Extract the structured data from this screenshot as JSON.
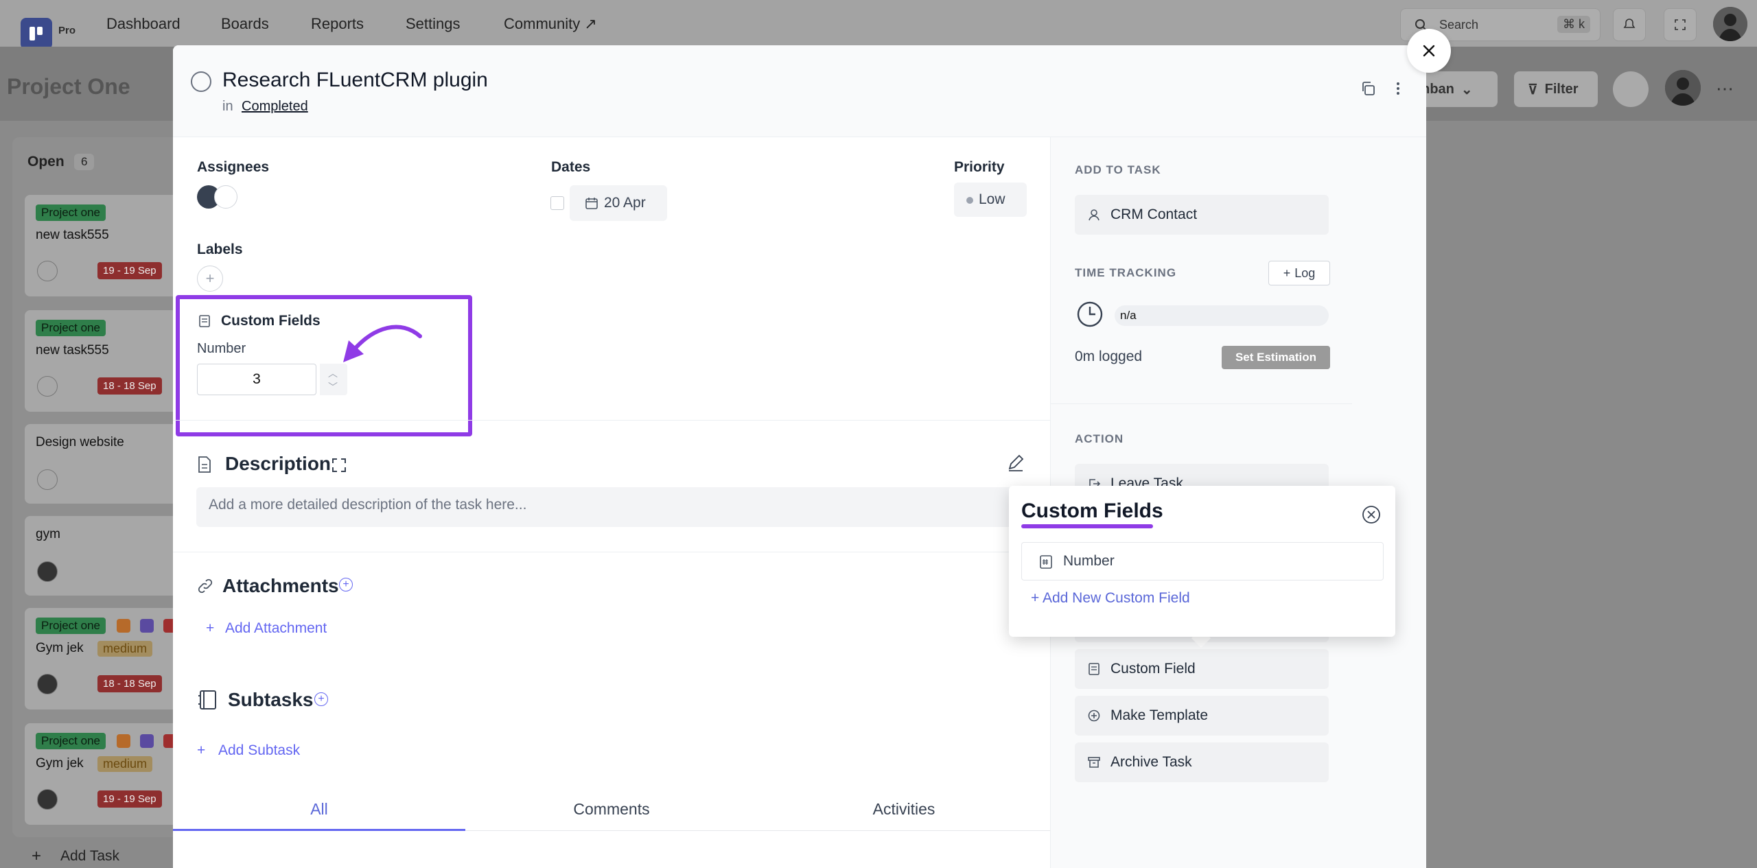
{
  "nav": {
    "brand": "Pro",
    "items": [
      "Dashboard",
      "Boards",
      "Reports",
      "Settings",
      "Community ↗"
    ],
    "search_label": "Search",
    "search_shortcut": "⌘ k"
  },
  "board": {
    "title": "Project One",
    "view_label": "anban",
    "filter_label": "Filter",
    "column": {
      "title": "Open",
      "count": "6",
      "cards": [
        {
          "tag": "Project one",
          "title": "new task555",
          "date": "19 - 19 Sep"
        },
        {
          "tag": "Project one",
          "title": "new task555",
          "date": "18 - 18 Sep"
        },
        {
          "title": "Design website"
        },
        {
          "title": "gym"
        },
        {
          "tag": "Project one",
          "title": "Gym jek",
          "priority": "medium",
          "date": "18 - 18 Sep"
        },
        {
          "tag": "Project one",
          "title": "Gym jek",
          "priority": "medium",
          "date": "19 - 19 Sep"
        }
      ],
      "add_task": "Add Task"
    }
  },
  "task": {
    "title": "Research FLuentCRM plugin",
    "in_label": "in",
    "stage": "Completed",
    "assignees_label": "Assignees",
    "dates_label": "Dates",
    "date_value": "20 Apr",
    "priority_label": "Priority",
    "priority_value": "Low",
    "labels_label": "Labels",
    "custom_fields_label": "Custom Fields",
    "number_label": "Number",
    "number_value": "3",
    "description_label": "Description",
    "description_placeholder": "Add a more detailed description of the task here...",
    "attachments_label": "Attachments",
    "add_attachment": "Add Attachment",
    "subtasks_label": "Subtasks",
    "add_subtask": "Add Subtask",
    "tabs": [
      "All",
      "Comments",
      "Activities"
    ]
  },
  "sidebar": {
    "add_to_task": "ADD TO TASK",
    "crm_contact": "CRM Contact",
    "time_tracking": "TIME TRACKING",
    "log": "Log",
    "estimate": "n/a",
    "logged": "0m logged",
    "set_estimation": "Set Estimation",
    "action": "ACTION",
    "leave_task": "Leave Task",
    "custom_field": "Custom Field",
    "make_template": "Make Template",
    "archive_task": "Archive Task"
  },
  "popover": {
    "title": "Custom Fields",
    "item": "Number",
    "add_new": "Add New Custom Field"
  },
  "colors": {
    "accent": "#6366f1",
    "highlight": "#8f3be6"
  }
}
